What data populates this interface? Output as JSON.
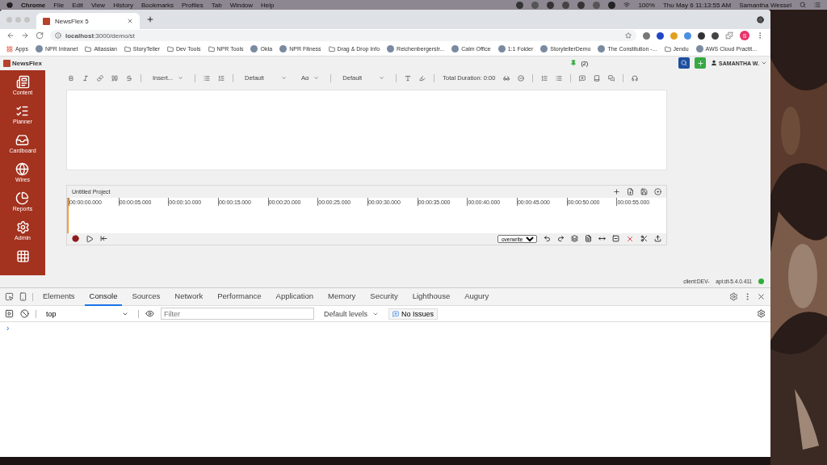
{
  "menu_bar": {
    "items": [
      "Chrome",
      "File",
      "Edit",
      "View",
      "History",
      "Bookmarks",
      "Profiles",
      "Tab",
      "Window",
      "Help"
    ],
    "battery": "100%",
    "clock": "Thu May 6  11:13:55 AM",
    "user": "Samantha Wessel"
  },
  "browser": {
    "tabs": [
      {
        "title": "NewsFlex 5",
        "selected": true
      }
    ],
    "url": "**localhost**:3000/demo/st",
    "profile_initial": "S",
    "bookmarks": [
      {
        "label": "Apps",
        "kind": "apps"
      },
      {
        "label": "NPR Intranet",
        "kind": "site"
      },
      {
        "label": "Atlassian",
        "kind": "folder"
      },
      {
        "label": "StoryTeller",
        "kind": "folder"
      },
      {
        "label": "Dev Tools",
        "kind": "folder"
      },
      {
        "label": "NPR Tools",
        "kind": "folder"
      },
      {
        "label": "Okta",
        "kind": "site"
      },
      {
        "label": "NPR Fitness",
        "kind": "site"
      },
      {
        "label": "Drag & Drop Info",
        "kind": "folder"
      },
      {
        "label": "Reichenbergerstr...",
        "kind": "site"
      },
      {
        "label": "Calm Office",
        "kind": "site"
      },
      {
        "label": "1:1 Folder",
        "kind": "site"
      },
      {
        "label": "StorytellerDemo",
        "kind": "site"
      },
      {
        "label": "The Constitution -...",
        "kind": "site"
      },
      {
        "label": "Jendu",
        "kind": "folder"
      },
      {
        "label": "AWS Cloud Practit...",
        "kind": "site"
      }
    ]
  },
  "app": {
    "logo": "NewsFlex",
    "pins": "(2)",
    "user": "SAMANTHA W.",
    "sidebar": [
      {
        "kind": "section",
        "label": "Content"
      },
      {
        "kind": "section",
        "label": "Planner"
      },
      {
        "kind": "section",
        "label": "Cardboard"
      },
      {
        "kind": "section",
        "label": "Wires"
      },
      {
        "kind": "section",
        "label": "Reports"
      },
      {
        "kind": "section",
        "label": "Admin"
      },
      {
        "kind": "apps"
      }
    ],
    "toolbar": {
      "insert": "Insert...",
      "font": "Default",
      "size": "Aα",
      "style": "Default",
      "duration": "Total Duration: 0:00"
    },
    "audio": {
      "title": "Untitled Project",
      "ticks": [
        "00:00:00.000",
        "00:00:05.000",
        "00:00:10.000",
        "00:00:15.000",
        "00:00:20.000",
        "00:00:25.000",
        "00:00:30.000",
        "00:00:35.000",
        "00:00:40.000",
        "00:00:45.000",
        "00:00:50.000",
        "00:00:55.000"
      ],
      "mode": "overwrite"
    },
    "status": {
      "client": "client:DEV-",
      "api": "api:dt-5.4.0.411",
      "online": true
    }
  },
  "devtools": {
    "tabs": [
      {
        "label": "Elements",
        "selected": false
      },
      {
        "label": "Console",
        "selected": true
      },
      {
        "label": "Sources",
        "selected": false
      },
      {
        "label": "Network",
        "selected": false
      },
      {
        "label": "Performance",
        "selected": false
      },
      {
        "label": "Application",
        "selected": false
      },
      {
        "label": "Memory",
        "selected": false
      },
      {
        "label": "Security",
        "selected": false
      },
      {
        "label": "Lighthouse",
        "selected": false
      },
      {
        "label": "Augury",
        "selected": false
      }
    ],
    "context": "top",
    "filter": {
      "placeholder": "Filter"
    },
    "levels": "Default levels",
    "issues": "No Issues",
    "prompt": "›"
  }
}
